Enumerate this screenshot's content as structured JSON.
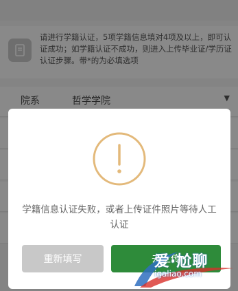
{
  "notice": {
    "text": "请进行学籍认证，5项学籍信息填对4项及以上，即可认证成功；如学籍认证不成功，则进入上传毕业证/学历证认证步骤。带*的为必填选项"
  },
  "form": {
    "rows": [
      {
        "label": "院系",
        "value": "哲学学院"
      }
    ]
  },
  "dialog": {
    "message": "学籍信息认证失败，或者上传证件照片等待人工认证",
    "retry_label": "重新填写",
    "upload_label": "去上传"
  },
  "watermark": {
    "title": "爱·尬聊",
    "url": "igaliao.com"
  },
  "colors": {
    "alert_icon": "#e3b97a",
    "primary_button": "#2e8b3a",
    "secondary_button": "#c8c8c8"
  }
}
